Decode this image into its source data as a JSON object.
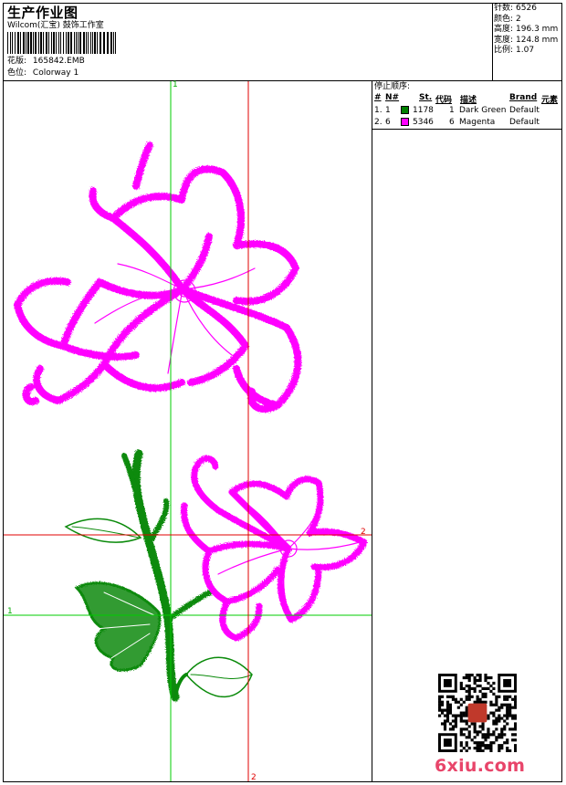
{
  "header": {
    "title": "生产作业图",
    "studio": "Wilcom(汇宝) 鼓饰工作室",
    "design_label": "花版:",
    "design_value": "165842.EMB",
    "colorway_label": "色位:",
    "colorway_value": "Colorway 1"
  },
  "stats": [
    {
      "label": "针数:",
      "value": "6526"
    },
    {
      "label": "颜色:",
      "value": "2"
    },
    {
      "label": "高度:",
      "value": "196.3 mm"
    },
    {
      "label": "宽度:",
      "value": "124.8 mm"
    },
    {
      "label": "比例:",
      "value": "1.07"
    }
  ],
  "stop_sequence": {
    "title": "停止顺序:",
    "columns": [
      "#",
      "N#",
      "St.",
      "代码",
      "描述",
      "Brand",
      "元素"
    ],
    "rows": [
      {
        "index": "1.",
        "n": "1",
        "stitches": "1178",
        "code": "1",
        "description": "Dark Green",
        "brand": "Default",
        "color": "#008000"
      },
      {
        "index": "2.",
        "n": "6",
        "stitches": "5346",
        "code": "6",
        "description": "Magenta",
        "brand": "Default",
        "color": "#ff00ff"
      }
    ]
  },
  "guides": {
    "green_labels": [
      "1",
      "1"
    ],
    "red_labels": [
      "2",
      "2"
    ],
    "green_color": "#00cc00",
    "red_color": "#e00000"
  },
  "thread_colors": {
    "magenta": "#ff00ff",
    "green": "#008000"
  },
  "watermark": {
    "site": "6xiu.com"
  }
}
